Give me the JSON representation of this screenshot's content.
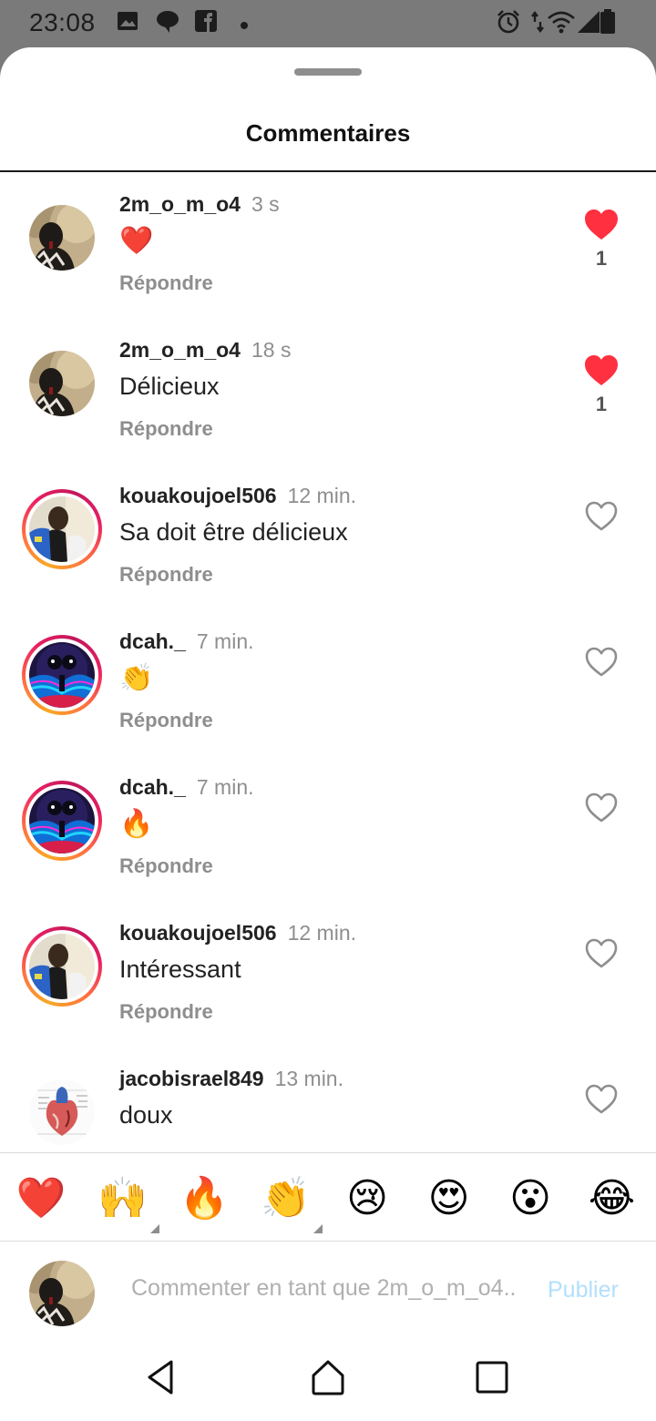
{
  "status_bar": {
    "time": "23:08",
    "left_icons": [
      "image-icon",
      "chat-bubble-icon",
      "facebook-icon",
      "dot-icon"
    ],
    "right_icons": [
      "alarm-icon",
      "data-arrows-icon",
      "wifi-icon",
      "signal-icon",
      "battery-icon"
    ]
  },
  "sheet": {
    "title": "Commentaires"
  },
  "comments": [
    {
      "username": "2m_o_m_o4",
      "time": "3 s",
      "text": "❤️",
      "emoji_only": true,
      "reply": "Répondre",
      "liked": true,
      "likes": "1",
      "avatar": "profile-photo-dark",
      "story_ring": false
    },
    {
      "username": "2m_o_m_o4",
      "time": "18 s",
      "text": "Délicieux",
      "emoji_only": false,
      "reply": "Répondre",
      "liked": true,
      "likes": "1",
      "avatar": "profile-photo-dark",
      "story_ring": false
    },
    {
      "username": "kouakoujoel506",
      "time": "12 min.",
      "text": "Sa doit être délicieux",
      "emoji_only": false,
      "reply": "Répondre",
      "liked": false,
      "likes": "",
      "avatar": "profile-photo-selfie",
      "story_ring": true
    },
    {
      "username": "dcah._",
      "time": "7 min.",
      "text": "👏",
      "emoji_only": true,
      "reply": "Répondre",
      "liked": false,
      "likes": "",
      "avatar": "profile-art-neon",
      "story_ring": true
    },
    {
      "username": "dcah._",
      "time": "7 min.",
      "text": "🔥",
      "emoji_only": true,
      "reply": "Répondre",
      "liked": false,
      "likes": "",
      "avatar": "profile-art-neon",
      "story_ring": true
    },
    {
      "username": "kouakoujoel506",
      "time": "12 min.",
      "text": "Intéressant",
      "emoji_only": false,
      "reply": "Répondre",
      "liked": false,
      "likes": "",
      "avatar": "profile-photo-selfie",
      "story_ring": true
    },
    {
      "username": "jacobisrael849",
      "time": "13 min.",
      "text": "doux",
      "emoji_only": false,
      "reply": "",
      "liked": false,
      "likes": "",
      "avatar": "profile-heart-anatomy",
      "story_ring": false
    }
  ],
  "reactions": [
    {
      "emoji": "❤️",
      "name": "heart",
      "has_more": false
    },
    {
      "emoji": "🙌",
      "name": "raised-hands",
      "has_more": true
    },
    {
      "emoji": "🔥",
      "name": "fire",
      "has_more": false
    },
    {
      "emoji": "👏",
      "name": "clapping-hands",
      "has_more": true
    },
    {
      "emoji": "😢",
      "name": "crying-face",
      "has_more": false
    },
    {
      "emoji": "😍",
      "name": "heart-eyes",
      "has_more": false
    },
    {
      "emoji": "😮",
      "name": "open-mouth",
      "has_more": false
    },
    {
      "emoji": "😂",
      "name": "tears-of-joy",
      "has_more": false
    }
  ],
  "composer": {
    "placeholder": "Commenter en tant que 2m_o_m_o4...",
    "publish_label": "Publier"
  },
  "nav_bar": {
    "buttons": [
      "back-icon",
      "home-icon",
      "recents-icon"
    ]
  },
  "colors": {
    "like_red": "#ff3040",
    "muted_text": "#8e8e8e",
    "publish_disabled": "#b2dffc",
    "status_bar_bg": "#7a7a7a"
  }
}
